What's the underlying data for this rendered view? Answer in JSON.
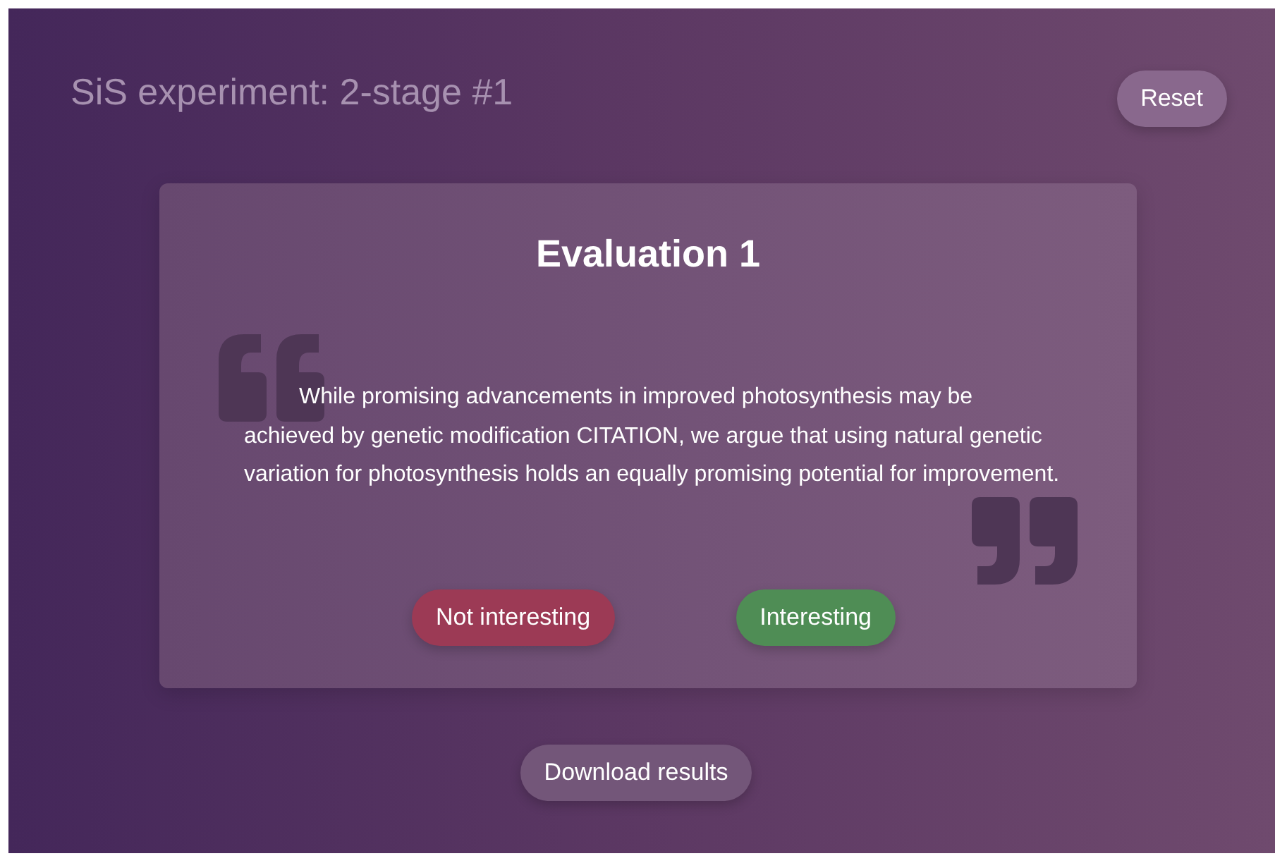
{
  "header": {
    "title": "SiS experiment: 2-stage #1",
    "reset_button": "Reset"
  },
  "evaluation": {
    "title": "Evaluation 1",
    "quote": "While promising advancements in improved photosynthesis may be achieved by genetic modification CITATION, we argue that using natural genetic variation for photosynthesis holds an equally promising potential for improvement.",
    "buttons": [
      {
        "label": "Not interesting",
        "kind": "negative"
      },
      {
        "label": "Interesting",
        "kind": "positive"
      }
    ]
  },
  "download_button": "Download results"
}
